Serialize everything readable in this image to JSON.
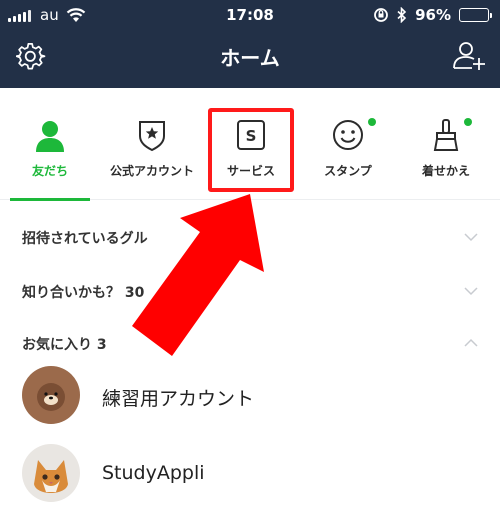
{
  "status_bar": {
    "carrier": "au",
    "time": "17:08",
    "battery": "96%",
    "battery_level": 0.96
  },
  "header": {
    "title": "ホーム",
    "left_icon": "gear-icon",
    "right_icon": "add-friend-icon"
  },
  "tabs": [
    {
      "label": "友だち",
      "icon": "person-icon",
      "active": true
    },
    {
      "label": "公式アカウント",
      "icon": "shield-star-icon",
      "active": false
    },
    {
      "label": "サービス",
      "icon": "s-box-icon",
      "active": false
    },
    {
      "label": "スタンプ",
      "icon": "smiley-icon",
      "active": false,
      "badge": true
    },
    {
      "label": "着せかえ",
      "icon": "brush-icon",
      "active": false,
      "badge": true
    }
  ],
  "sections": {
    "invited_groups": "招待されているグル",
    "maybe_know": "知り合いかも？ 30",
    "favorites": "お気に入り 3"
  },
  "friends": [
    {
      "name": "練習用アカウント",
      "avatar": "bear-avatar"
    },
    {
      "name": "StudyAppli",
      "avatar": "kitten-avatar"
    }
  ],
  "colors": {
    "header_bg": "#223047",
    "accent_green": "#1db83a",
    "annotation_red": "#ff1a1a"
  }
}
